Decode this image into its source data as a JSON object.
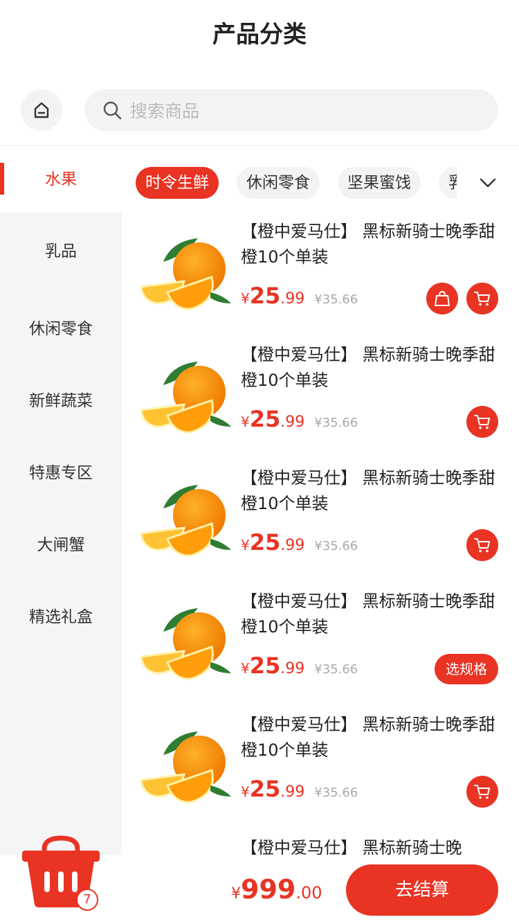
{
  "header": {
    "title": "产品分类"
  },
  "search": {
    "placeholder": "搜索商品"
  },
  "sidebar": {
    "items": [
      {
        "label": "水果",
        "active": true
      },
      {
        "label": "乳品"
      },
      {
        "label": "休闲零食"
      },
      {
        "label": "新鲜蔬菜"
      },
      {
        "label": "特惠专区"
      },
      {
        "label": "大闸蟹"
      },
      {
        "label": "精选礼盒"
      }
    ]
  },
  "tabs": [
    {
      "label": "时令生鲜",
      "active": true
    },
    {
      "label": "休闲零食"
    },
    {
      "label": "坚果蜜饯"
    },
    {
      "label": "乳"
    }
  ],
  "products": [
    {
      "name": "【橙中爱马仕】 黑标新骑士晚季甜橙10个单装",
      "currency": "¥",
      "price_int": "25",
      "price_dec": ".99",
      "old_price": "¥35.66",
      "action": "bag+cart"
    },
    {
      "name": "【橙中爱马仕】 黑标新骑士晚季甜橙10个单装",
      "currency": "¥",
      "price_int": "25",
      "price_dec": ".99",
      "old_price": "¥35.66",
      "action": "cart"
    },
    {
      "name": "【橙中爱马仕】 黑标新骑士晚季甜橙10个单装",
      "currency": "¥",
      "price_int": "25",
      "price_dec": ".99",
      "old_price": "¥35.66",
      "action": "cart"
    },
    {
      "name": "【橙中爱马仕】 黑标新骑士晚季甜橙10个单装",
      "currency": "¥",
      "price_int": "25",
      "price_dec": ".99",
      "old_price": "¥35.66",
      "action": "spec",
      "spec_label": "选规格"
    },
    {
      "name": "【橙中爱马仕】 黑标新骑士晚季甜橙10个单装",
      "currency": "¥",
      "price_int": "25",
      "price_dec": ".99",
      "old_price": "¥35.66",
      "action": "cart"
    },
    {
      "name": "【橙中爱马仕】 黑标新骑士晚",
      "partial": true
    }
  ],
  "cart": {
    "count": "7",
    "currency": "¥",
    "total_int": "999",
    "total_dec": ".00",
    "checkout_label": "去结算"
  },
  "colors": {
    "accent": "#e93323",
    "sidebar_bg": "#f5f5f5",
    "muted": "#aaaaaa"
  }
}
